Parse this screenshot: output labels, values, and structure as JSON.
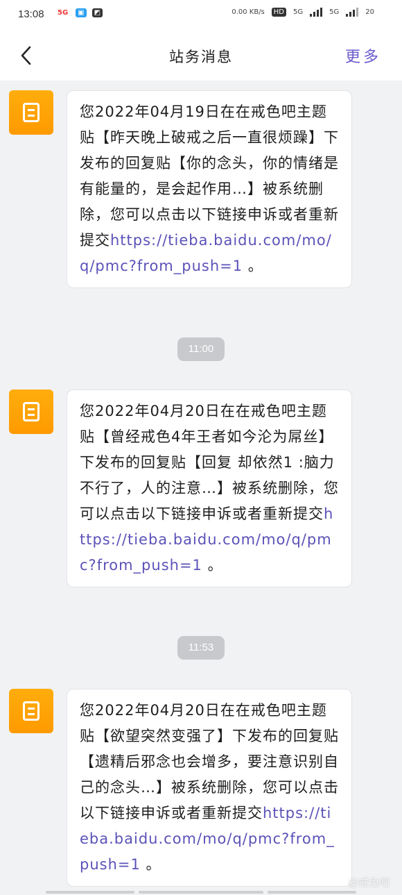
{
  "status_bar": {
    "time": "13:08",
    "net_speed": "0.00 KB/s",
    "hd": "HD",
    "signal1": "5G",
    "signal2": "5G",
    "battery": "20"
  },
  "header": {
    "title": "站务消息",
    "more_label": "更多"
  },
  "messages": [
    {
      "text": "您2022年04月19日在在戒色吧主题贴【昨天晚上破戒之后一直很烦躁】下发布的回复贴【你的念头，你的情绪是有能量的，是会起作用…】被系统删除，您可以点击以下链接申诉或者重新提交",
      "link": "https://tieba.baidu.com/mo/q/pmc?from_push=1",
      "suffix": " 。"
    },
    {
      "timestamp": "11:00",
      "text": "您2022年04月20日在在戒色吧主题贴【曾经戒色4年王者如今沦为屌丝】下发布的回复贴【回复 却依然1 :脑力不行了，人的注意…】被系统删除，您可以点击以下链接申诉或者重新提交",
      "link": "https://tieba.baidu.com/mo/q/pmc?from_push=1",
      "suffix": " 。"
    },
    {
      "timestamp": "11:53",
      "text": "您2022年04月20日在在戒色吧主题贴【欲望突然变强了】下发布的回复贴【遗精后邪念也会增多，要注意识别自己的念头…】被系统删除，您可以点击以下链接申诉或者重新提交",
      "link": "https://tieba.baidu.com/mo/q/pmc?from_push=1",
      "suffix": " 。"
    }
  ],
  "watermark": "@戒色吧",
  "colors": {
    "accent": "#6a5acd",
    "link": "#5b52b8",
    "avatar": "#ff9f00",
    "background": "#f1f2f4"
  }
}
